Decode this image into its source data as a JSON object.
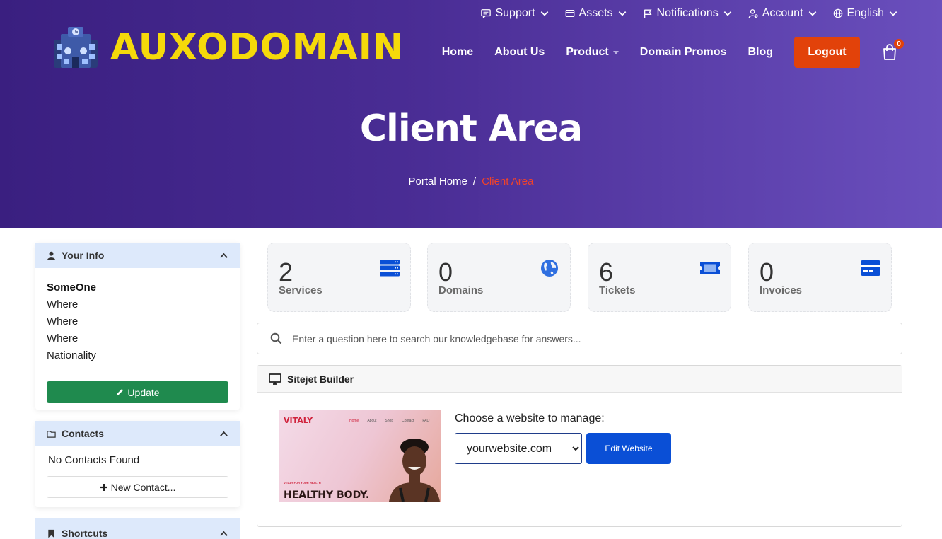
{
  "topbar": {
    "support": "Support",
    "assets": "Assets",
    "notifications": "Notifications",
    "account": "Account",
    "language": "English"
  },
  "brand": {
    "name": "AUXODOMAIN",
    "color": "#f5d90a"
  },
  "nav": {
    "home": "Home",
    "about": "About Us",
    "product": "Product",
    "promos": "Domain Promos",
    "blog": "Blog",
    "logout": "Logout",
    "cart_count": "0"
  },
  "hero": {
    "title": "Client Area",
    "breadcrumb_home": "Portal Home",
    "breadcrumb_sep": "/",
    "breadcrumb_current": "Client Area"
  },
  "your_info": {
    "title": "Your Info",
    "name": "SomeOne",
    "lines": [
      "Where",
      "Where",
      "Where",
      "Nationality"
    ],
    "update": "Update"
  },
  "contacts": {
    "title": "Contacts",
    "empty": "No Contacts Found",
    "new": "New Contact..."
  },
  "shortcuts": {
    "title": "Shortcuts"
  },
  "stats": [
    {
      "num": "2",
      "label": "Services",
      "icon": "server-icon"
    },
    {
      "num": "0",
      "label": "Domains",
      "icon": "globe-icon"
    },
    {
      "num": "6",
      "label": "Tickets",
      "icon": "ticket-icon"
    },
    {
      "num": "0",
      "label": "Invoices",
      "icon": "credit-card-icon"
    }
  ],
  "kb": {
    "placeholder": "Enter a question here to search our knowledgebase for answers..."
  },
  "sitejet": {
    "title": "Sitejet Builder",
    "choose": "Choose a website to manage:",
    "selected": "yourwebsite.com",
    "edit": "Edit Website",
    "thumb": {
      "brand": "VITALY",
      "menu": [
        "Home",
        "About",
        "Shop",
        "Contact",
        "FAQ"
      ],
      "kicker": "VITALY FOR YOUR HEALTH",
      "headline": "HEALTHY BODY."
    }
  },
  "colors": {
    "accent": "#e2420a",
    "primary_blue": "#0a4fd6",
    "success": "#1f8a4e",
    "icon_blue": "#0a4fd6"
  }
}
